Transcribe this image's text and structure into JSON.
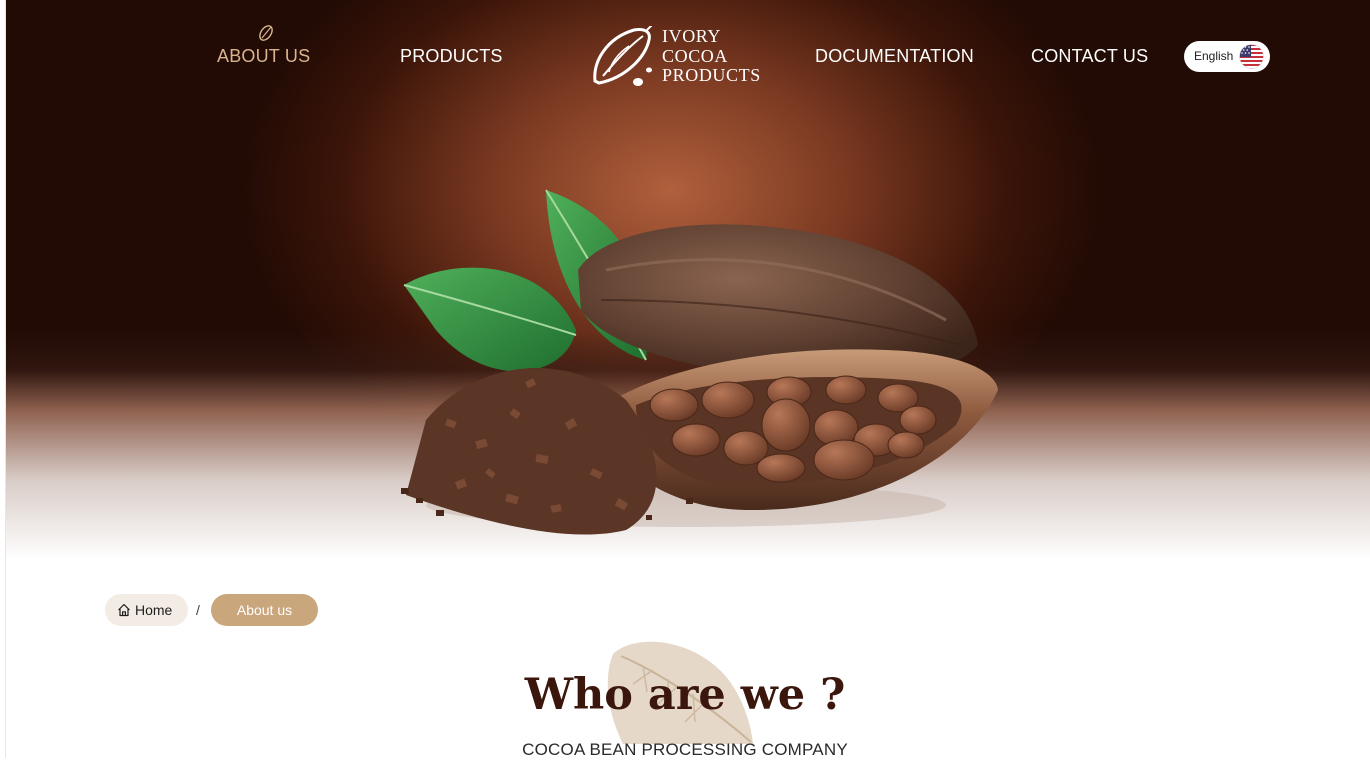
{
  "nav": {
    "about": "ABOUT US",
    "products": "PRODUCTS",
    "documentation": "DOCUMENTATION",
    "contact": "CONTACT US"
  },
  "logo": {
    "line1": "IVORY",
    "line2": "COCOA",
    "line3": "PRODUCTS"
  },
  "language": {
    "label": "English",
    "flag_icon": "us-flag-icon"
  },
  "breadcrumb": {
    "home": "Home",
    "separator": "/",
    "current": "About us"
  },
  "section": {
    "title": "Who are we ?",
    "subtitle": "COCOA BEAN PROCESSING COMPANY"
  },
  "colors": {
    "accent": "#c9a67c",
    "nav_active": "#d9b48c",
    "title": "#3b160c",
    "hero_dark": "#220b05"
  }
}
